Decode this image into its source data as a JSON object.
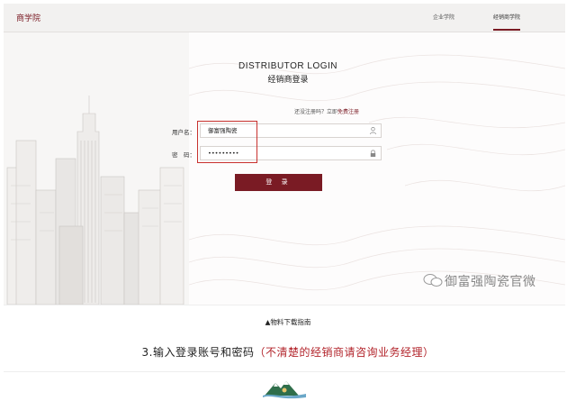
{
  "header": {
    "brand": "商学院",
    "nav": [
      "企业学院",
      "经销商学院"
    ],
    "active_nav": "经销商学院",
    "accent_color": "#7a1b24"
  },
  "login": {
    "title_en": "DISTRIBUTOR LOGIN",
    "title_cn": "经销商登录",
    "register_prompt": "还没注册吗？立即",
    "register_link": "免费注册",
    "username_label": "用户名：",
    "username_value": "御富强陶瓷",
    "username_icon": "user-icon",
    "password_label": "密　码：",
    "password_value": "•••••••••",
    "password_icon": "lock-icon",
    "submit_label": "登 录"
  },
  "watermark": "御富强陶瓷官微",
  "guide": {
    "download": "▲物料下载指南",
    "step_text": "3.输入登录账号和密码",
    "step_note": "（不清楚的经销商请咨询业务经理）"
  },
  "highlight_color": "#c8312e"
}
